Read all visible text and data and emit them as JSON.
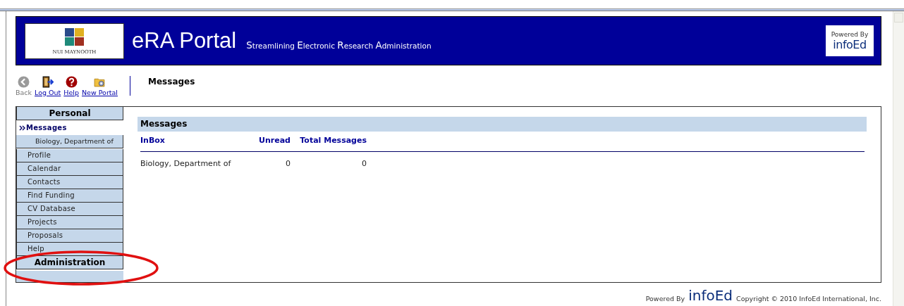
{
  "header": {
    "title": "eRA Portal",
    "subtitle": "Streamlining Electronic Research Administration",
    "logo_caption": "NUI MAYNOOTH",
    "badge": {
      "caption": "Powered By",
      "brand": "infoEd"
    }
  },
  "toolbar": {
    "items": [
      {
        "kind": "back",
        "label": "Back",
        "disabled": true
      },
      {
        "kind": "logout",
        "label": "Log Out",
        "disabled": false
      },
      {
        "kind": "help",
        "label": "Help",
        "disabled": false
      },
      {
        "kind": "portal",
        "label": "New Portal",
        "disabled": false
      }
    ],
    "page_title": "Messages"
  },
  "sidebar": {
    "sections": [
      {
        "title": "Personal",
        "items": [
          {
            "label": "Messages",
            "selected": true,
            "children": [
              {
                "label": "Biology, Department of",
                "selected": false
              }
            ]
          },
          {
            "label": "Profile",
            "selected": false
          },
          {
            "label": "Calendar",
            "selected": false
          },
          {
            "label": "Contacts",
            "selected": false
          },
          {
            "label": "Find Funding",
            "selected": false
          },
          {
            "label": "CV Database",
            "selected": false
          },
          {
            "label": "Projects",
            "selected": false
          },
          {
            "label": "Proposals",
            "selected": false
          },
          {
            "label": "Help",
            "selected": false
          }
        ]
      },
      {
        "title": "Administration"
      }
    ]
  },
  "messages": {
    "title": "Messages",
    "columns": [
      "InBox",
      "Unread",
      "Total Messages"
    ],
    "rows": [
      [
        "Biology, Department of",
        "0",
        "0"
      ]
    ]
  },
  "footer": {
    "powered_by": "Powered By",
    "brand": "infoEd",
    "copyright": "Copyright © 2010 InfoEd International, Inc."
  }
}
